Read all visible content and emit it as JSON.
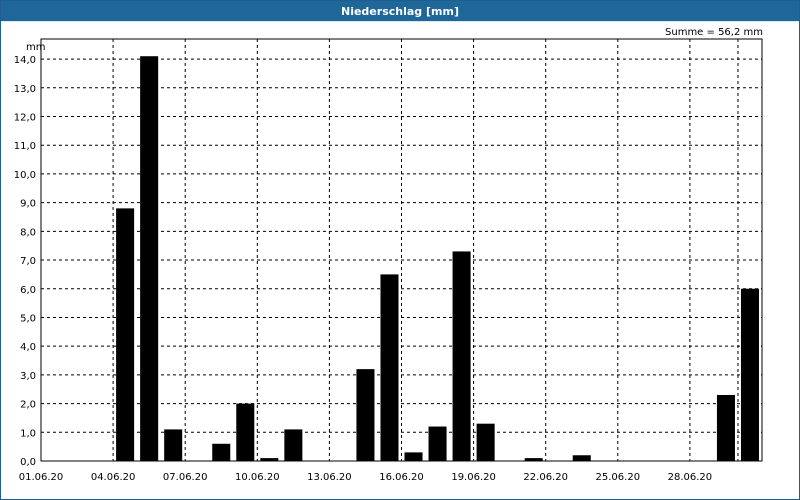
{
  "window": {
    "title": "Niederschlag [mm]"
  },
  "annotation": {
    "summe": "Summe = 56,2 mm"
  },
  "chart_data": {
    "type": "bar",
    "title": "Niederschlag [mm]",
    "ylabel": "mm",
    "ylim": [
      0,
      14.7
    ],
    "grid": true,
    "yticks": [
      "0,0",
      "1,0",
      "2,0",
      "3,0",
      "4,0",
      "5,0",
      "6,0",
      "7,0",
      "8,0",
      "9,0",
      "10,0",
      "11,0",
      "12,0",
      "13,0",
      "14,0"
    ],
    "xticks": [
      "01.06.20",
      "04.06.20",
      "07.06.20",
      "10.06.20",
      "13.06.20",
      "16.06.20",
      "19.06.20",
      "22.06.20",
      "25.06.20",
      "28.06.20"
    ],
    "categories": [
      "01.06.20",
      "02.06.20",
      "03.06.20",
      "04.06.20",
      "05.06.20",
      "06.06.20",
      "07.06.20",
      "08.06.20",
      "09.06.20",
      "10.06.20",
      "11.06.20",
      "12.06.20",
      "13.06.20",
      "14.06.20",
      "15.06.20",
      "16.06.20",
      "17.06.20",
      "18.06.20",
      "19.06.20",
      "20.06.20",
      "21.06.20",
      "22.06.20",
      "23.06.20",
      "24.06.20",
      "25.06.20",
      "26.06.20",
      "27.06.20",
      "28.06.20",
      "29.06.20",
      "30.06.20"
    ],
    "values": [
      0,
      0,
      0,
      8.8,
      14.1,
      1.1,
      0,
      0.6,
      2.0,
      0.1,
      1.1,
      0,
      0,
      3.2,
      6.5,
      0.3,
      1.2,
      7.3,
      1.3,
      0,
      0.1,
      0,
      0.2,
      0,
      0,
      0,
      0,
      0,
      2.3,
      6.0
    ],
    "colors": {
      "bar": "#000000",
      "grid": "#000000",
      "axis": "#000000"
    }
  }
}
